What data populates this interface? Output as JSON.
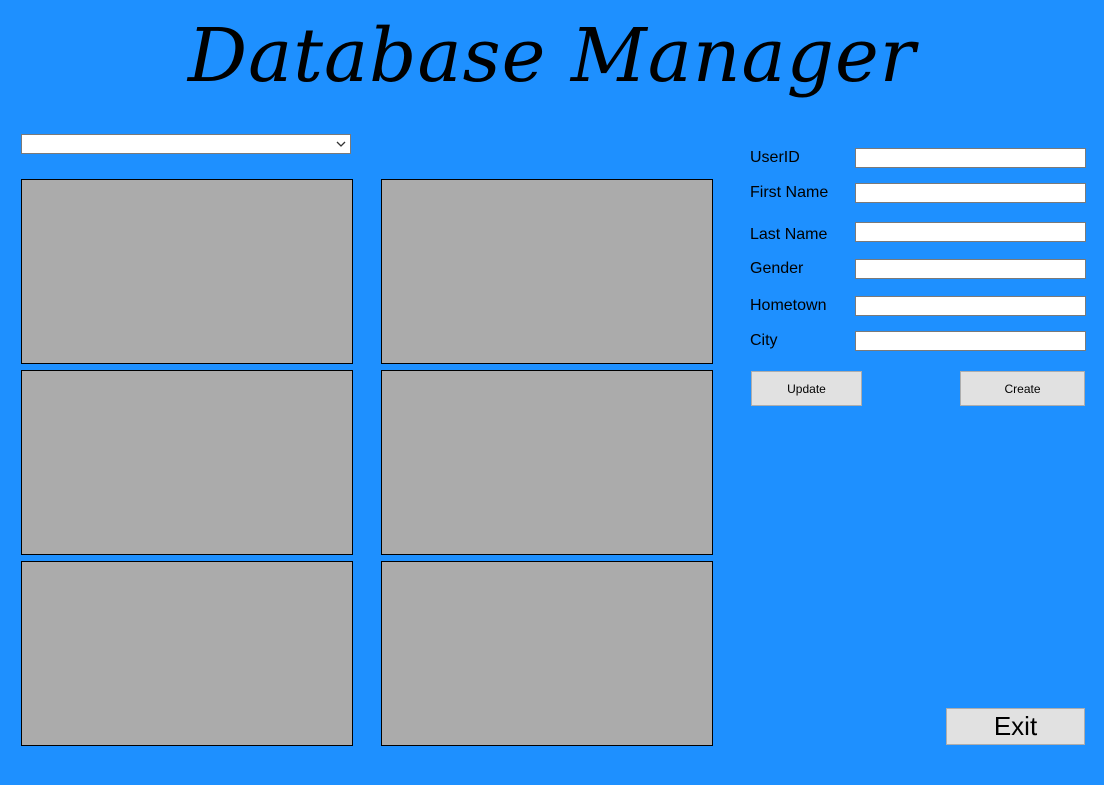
{
  "app": {
    "title": "Database Manager"
  },
  "selector": {
    "value": ""
  },
  "panels": [
    {
      "id": "panel-1"
    },
    {
      "id": "panel-2"
    },
    {
      "id": "panel-3"
    },
    {
      "id": "panel-4"
    },
    {
      "id": "panel-5"
    },
    {
      "id": "panel-6"
    }
  ],
  "form": {
    "fields": [
      {
        "label": "UserID",
        "value": ""
      },
      {
        "label": "First Name",
        "value": ""
      },
      {
        "label": "Last Name",
        "value": ""
      },
      {
        "label": "Gender",
        "value": ""
      },
      {
        "label": "Hometown",
        "value": ""
      },
      {
        "label": "City",
        "value": ""
      }
    ],
    "update_label": "Update",
    "create_label": "Create"
  },
  "exit_label": "Exit",
  "colors": {
    "background": "#1e90ff",
    "panel": "#ababab",
    "button": "#e1e1e1"
  },
  "icons": {
    "dropdown": "chevron-down-icon"
  }
}
